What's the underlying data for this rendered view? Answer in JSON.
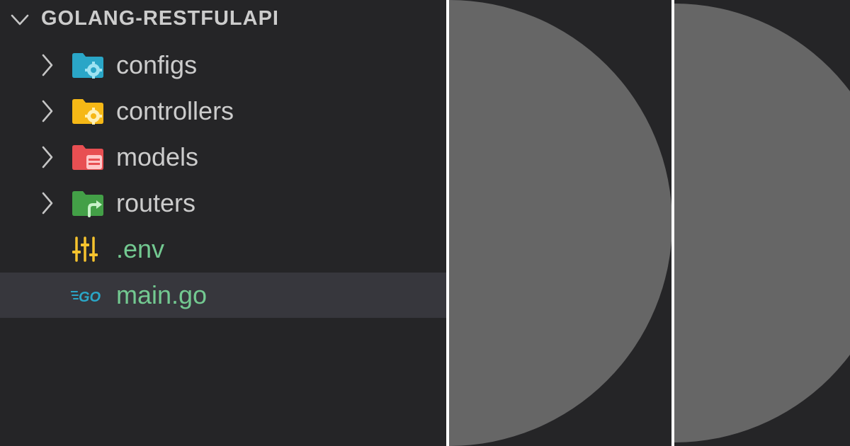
{
  "explorer": {
    "section_title": "GOLANG-RESTFULAPI",
    "items": [
      {
        "label": "configs",
        "kind": "folder",
        "icon": "folder-config-icon",
        "color": "#2aa6c7"
      },
      {
        "label": "controllers",
        "kind": "folder",
        "icon": "folder-controller-icon",
        "color": "#f6b816"
      },
      {
        "label": "models",
        "kind": "folder",
        "icon": "folder-database-icon",
        "color": "#e84f52"
      },
      {
        "label": "routers",
        "kind": "folder",
        "icon": "folder-routes-icon",
        "color": "#43a047"
      },
      {
        "label": ".env",
        "kind": "file",
        "icon": "env-settings-icon",
        "color": "#f6c32e"
      },
      {
        "label": "main.go",
        "kind": "file",
        "icon": "go-file-icon",
        "color": "#2aa6c7",
        "selected": true
      }
    ]
  },
  "colors": {
    "background": "#252527",
    "selected_row": "#37373d",
    "text": "#cccccc",
    "file_text_green": "#73c991",
    "decorative_circle": "#666666",
    "divider": "#ffffff"
  }
}
